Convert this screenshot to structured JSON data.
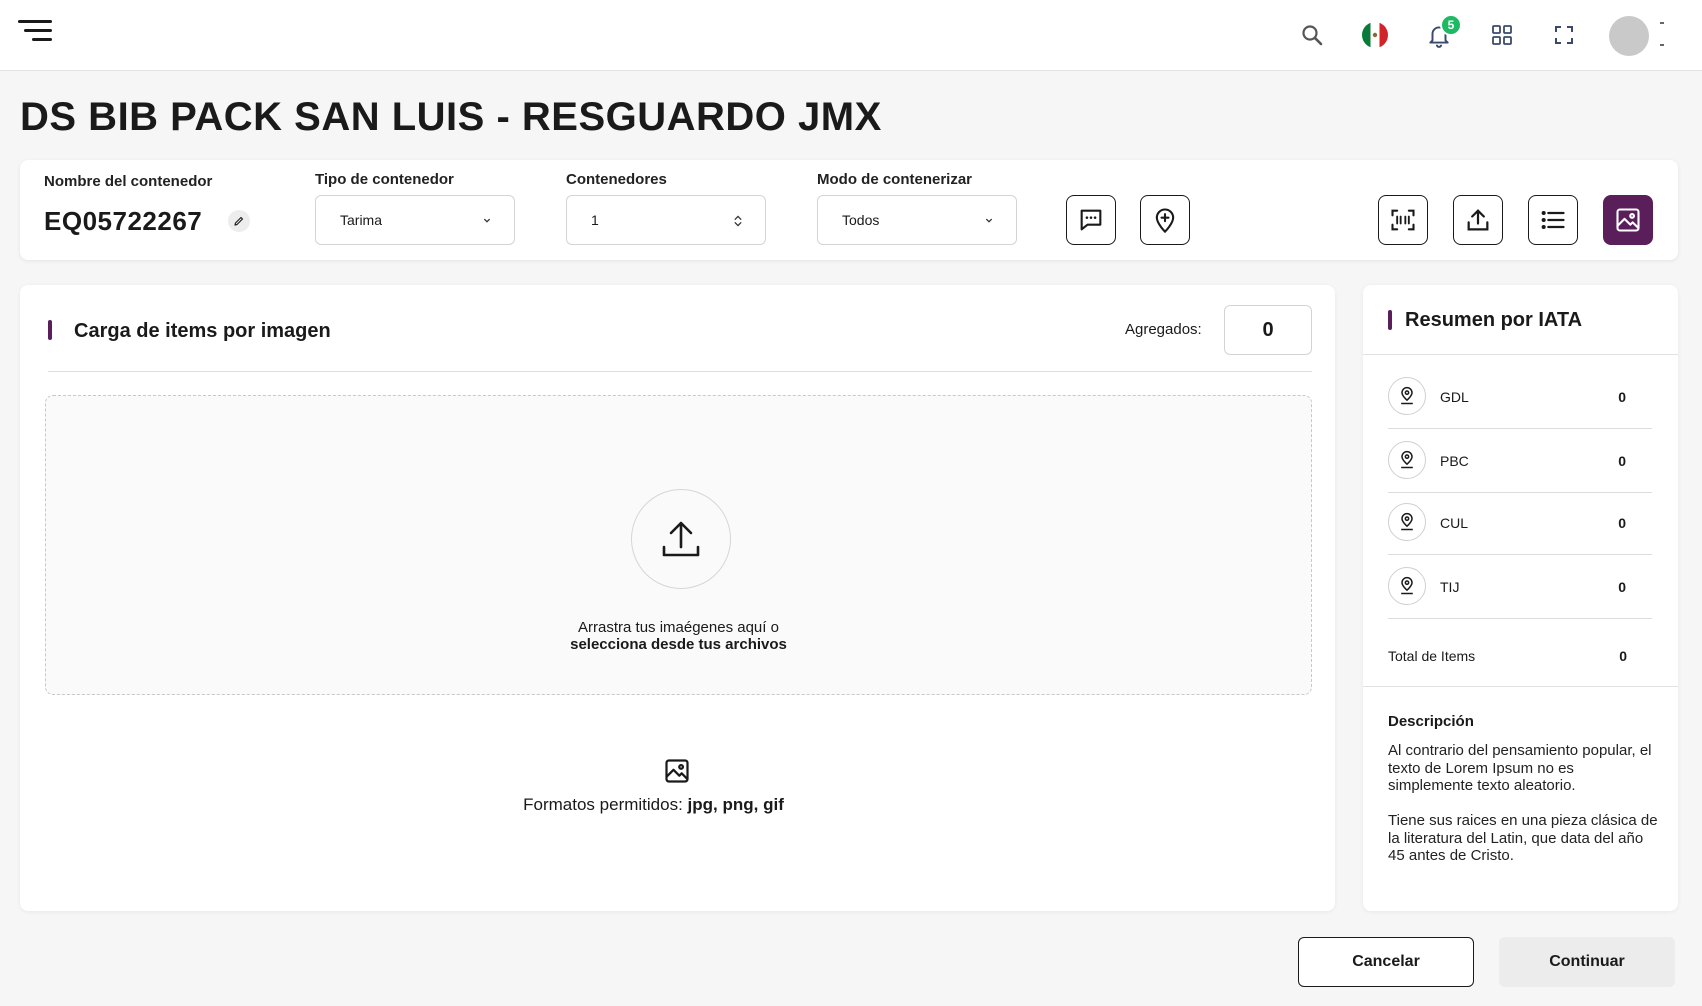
{
  "header": {
    "notification_count": "5",
    "icons": [
      "menu-icon",
      "search-icon",
      "mexico-flag-icon",
      "bell-icon",
      "apps-grid-icon",
      "fullscreen-icon",
      "avatar"
    ]
  },
  "page": {
    "title": "DS BIB PACK SAN LUIS - RESGUARDO JMX"
  },
  "config": {
    "container_name_label": "Nombre del contenedor",
    "container_name": "EQ05722267",
    "container_type_label": "Tipo de contenedor",
    "container_type_value": "Tarima",
    "containers_label": "Contenedores",
    "containers_value": "1",
    "mode_label": "Modo de contenerizar",
    "mode_value": "Todos",
    "toolbar_icons": [
      "comment-icon",
      "add-location-icon",
      "scan-icon",
      "upload-icon",
      "list-icon",
      "image-icon"
    ]
  },
  "upload": {
    "title": "Carga de items por imagen",
    "added_label": "Agregados:",
    "added_value": "0",
    "drop_text": "Arrastra tus imaégenes aquí o",
    "drop_link": "selecciona desde tus archivos",
    "formats_label": "Formatos permitidos:",
    "formats_value": "jpg, png, gif"
  },
  "summary": {
    "title": "Resumen por IATA",
    "rows": [
      {
        "code": "GDL",
        "count": "0"
      },
      {
        "code": "PBC",
        "count": "0"
      },
      {
        "code": "CUL",
        "count": "0"
      },
      {
        "code": "TIJ",
        "count": "0"
      }
    ],
    "total_label": "Total de Items",
    "total_value": "0",
    "description_title": "Descripción",
    "description_p1": "Al contrario del pensamiento popular, el texto de Lorem Ipsum no es simplemente texto aleatorio.",
    "description_p2": "Tiene sus raices en una pieza clásica de la literatura del Latin, que data del año 45 antes de Cristo."
  },
  "actions": {
    "cancel": "Cancelar",
    "continue": "Continuar"
  },
  "colors": {
    "accent": "#5a1f5b",
    "badge": "#1fb865",
    "background": "#f6f6f6"
  }
}
